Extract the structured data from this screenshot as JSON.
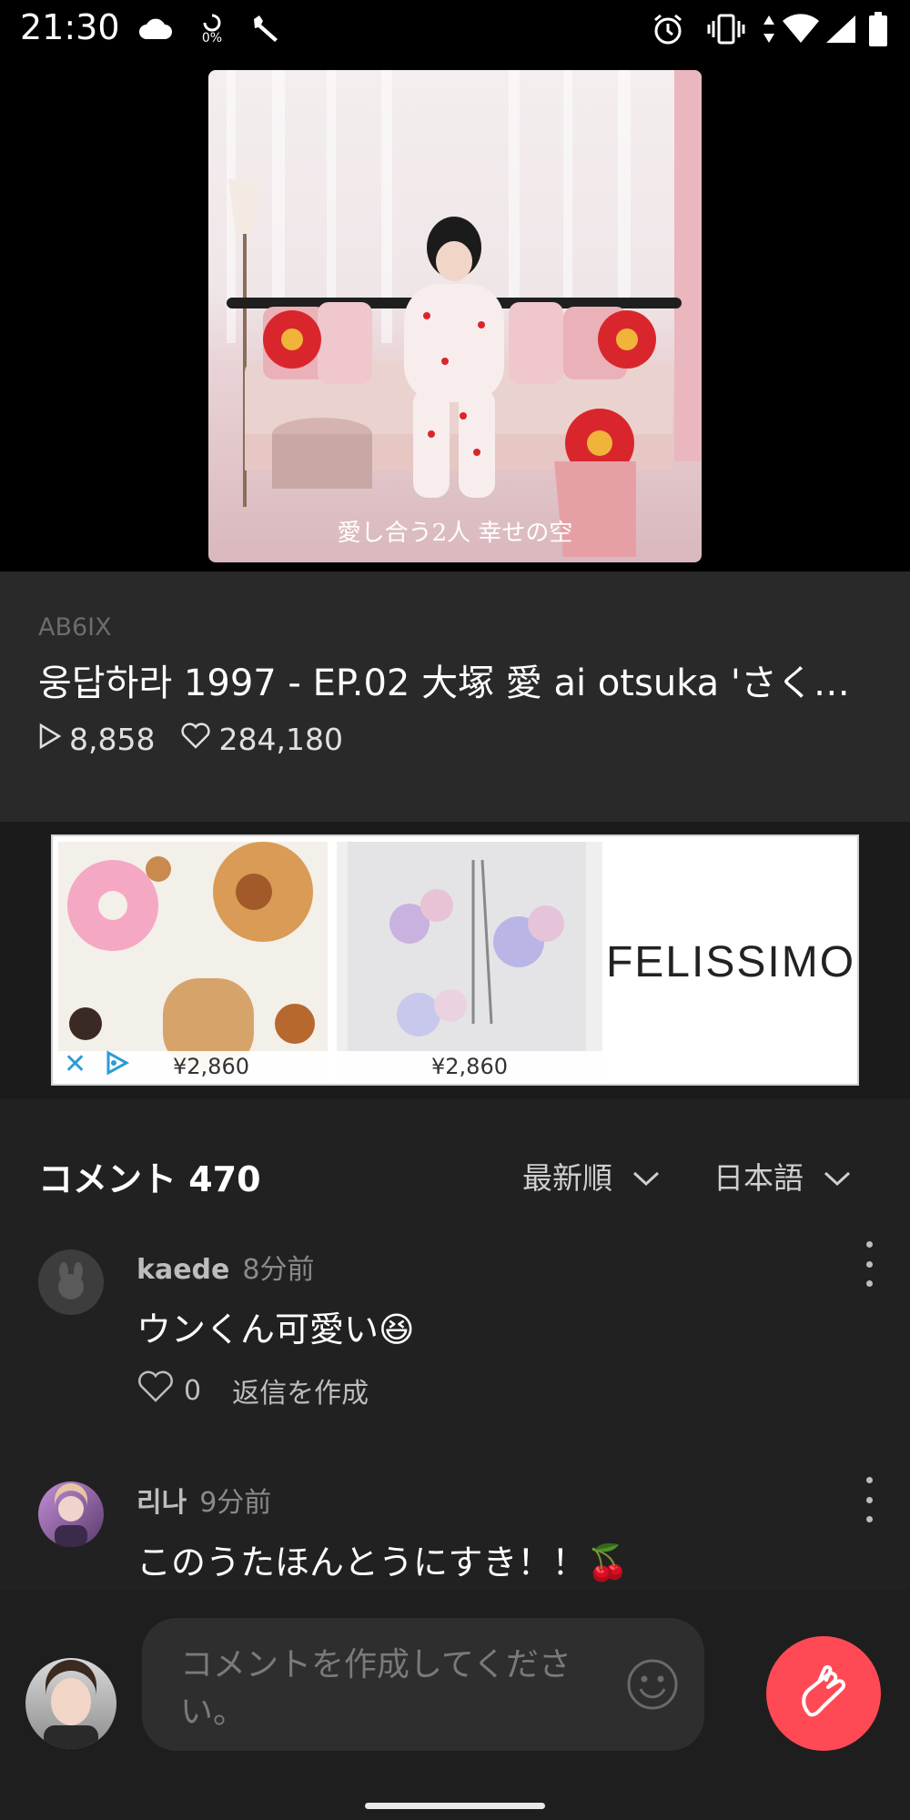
{
  "status_bar": {
    "time": "21:30",
    "data_percent": "0%",
    "icons": [
      "cloud-icon",
      "data-saver-icon",
      "wrench-icon",
      "alarm-icon",
      "vibrate-icon",
      "data-arrows-icon",
      "wifi-icon",
      "signal-icon",
      "battery-icon"
    ]
  },
  "video": {
    "caption": "愛し合う2人 幸せの空"
  },
  "info": {
    "channel": "AB6IX",
    "title": "웅답하라 1997 - EP.02 大塚 愛 ai otsuka 'さくら...",
    "plays": "8,858",
    "likes": "284,180"
  },
  "ad": {
    "items": [
      {
        "price": "¥2,860"
      },
      {
        "price": "¥2,860"
      }
    ],
    "brand": "FELISSIMO"
  },
  "comments": {
    "header": "コメント 470",
    "sort_label": "最新順",
    "language_label": "日本語",
    "items": [
      {
        "user": "kaede",
        "time": "8分前",
        "text": "ウンくん可愛い😆",
        "likes": "0",
        "reply_label": "返信を作成"
      },
      {
        "user": "리나",
        "time": "9分前",
        "text": "このうたほんとうにすき！！🍒"
      }
    ]
  },
  "composer": {
    "placeholder": "コメントを作成してください。"
  },
  "colors": {
    "accent": "#ff4a55",
    "background": "#212121",
    "info_background": "#292929"
  }
}
